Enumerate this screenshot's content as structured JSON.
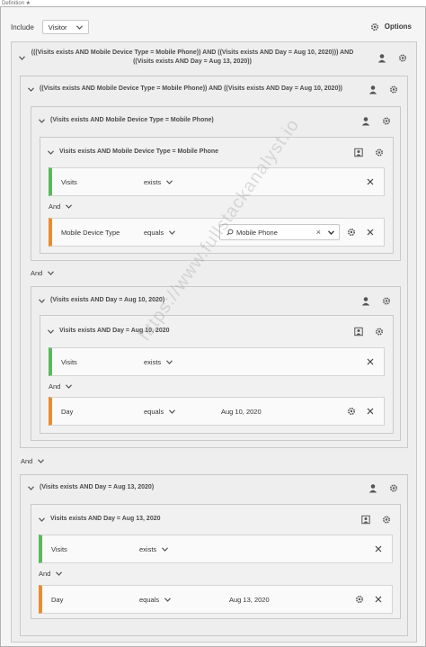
{
  "definition_label": "Definition ★",
  "include": {
    "label": "Include",
    "value": "Visitor"
  },
  "options_label": "Options",
  "outer": {
    "title_line1": "(((Visits exists AND Mobile Device Type = Mobile Phone)) AND ((Visits exists AND Day = Aug 10, 2020))) AND",
    "title_line2": "((Visits exists AND Day = Aug 13, 2020))"
  },
  "group_a": {
    "title": "((Visits exists AND Mobile Device Type = Mobile Phone)) AND ((Visits exists AND Day = Aug 10, 2020))"
  },
  "group_a1": {
    "title": "(Visits exists AND Mobile Device Type = Mobile Phone)"
  },
  "group_a1_inner": {
    "title": "Visits exists AND Mobile Device Type = Mobile Phone"
  },
  "group_a2": {
    "title": "(Visits exists AND Day = Aug 10, 2020)"
  },
  "group_a2_inner": {
    "title": "Visits exists AND Day = Aug 10, 2020"
  },
  "group_b": {
    "title": "(Visits exists AND Day = Aug 13, 2020)"
  },
  "group_b_inner": {
    "title": "Visits exists AND Day = Aug 13, 2020"
  },
  "rules": {
    "r1": {
      "name": "Visits",
      "op": "exists"
    },
    "r2": {
      "name": "Mobile Device Type",
      "op": "equals",
      "value": "Mobile Phone"
    },
    "r3": {
      "name": "Visits",
      "op": "exists"
    },
    "r4": {
      "name": "Day",
      "op": "equals",
      "value": "Aug 10, 2020"
    },
    "r5": {
      "name": "Visits",
      "op": "exists"
    },
    "r6": {
      "name": "Day",
      "op": "equals",
      "value": "Aug 13, 2020"
    }
  },
  "and_label": "And",
  "watermark": "https://www.fullstackanalyst.io",
  "colors": {
    "metric": "#5cb85c",
    "dimension": "#e88d2f"
  },
  "icons": [
    "gear-icon",
    "person-icon",
    "segment-icon",
    "close-icon",
    "chevron-down-icon",
    "search-icon"
  ]
}
